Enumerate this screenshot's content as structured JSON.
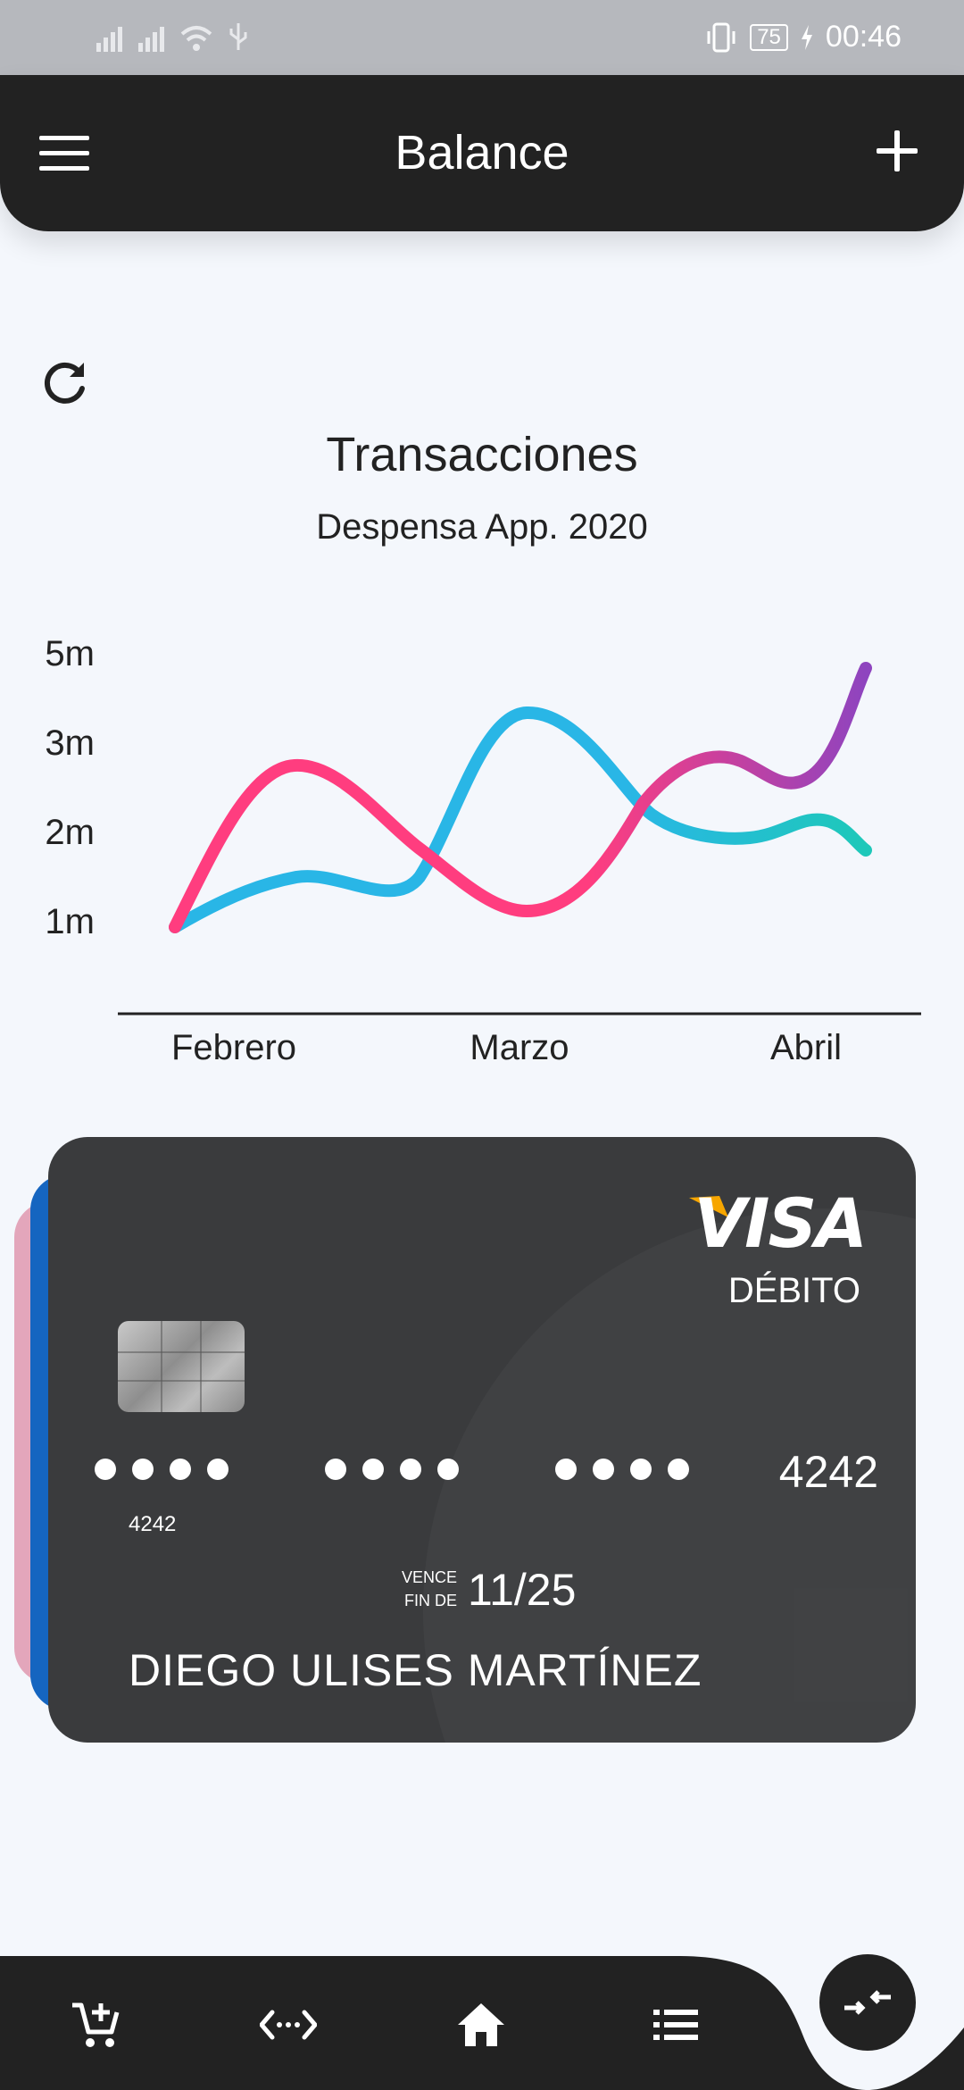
{
  "status_bar": {
    "battery": "75",
    "time": "00:46"
  },
  "app_bar": {
    "title": "Balance"
  },
  "chart_data": {
    "type": "line",
    "title": "Transacciones",
    "subtitle": "Despensa App. 2020",
    "categories": [
      "Febrero",
      "Marzo",
      "Abril"
    ],
    "y_ticks": [
      "5m",
      "3m",
      "2m",
      "1m"
    ],
    "series": [
      {
        "values": [
          1,
          1.6,
          1.5,
          3.4,
          2.0,
          2.3,
          1.9
        ],
        "colors": [
          "#29b6e6",
          "#1ec8b9"
        ]
      },
      {
        "values": [
          1,
          2.8,
          1.2,
          2.8,
          2.6,
          5.0
        ],
        "colors": [
          "#ff3d7f",
          "#8e44bf"
        ]
      }
    ]
  },
  "card": {
    "brand": "VISA",
    "type": "DÉBITO",
    "last4": "4242",
    "small_number": "4242",
    "expiry_label_1": "VENCE",
    "expiry_label_2": "FIN DE",
    "expiry": "11/25",
    "holder": "DIEGO ULISES MARTÍNEZ"
  },
  "bottom_nav": {
    "items": [
      "add-cart-icon",
      "code-arrows-icon",
      "home-icon",
      "list-icon"
    ],
    "fab_icon": "compress-arrows-icon"
  },
  "colors": {
    "dark": "#222222",
    "card": "#3a3b3d",
    "accent_blue": "#1565c0",
    "accent_pink": "#e3a6bb"
  }
}
